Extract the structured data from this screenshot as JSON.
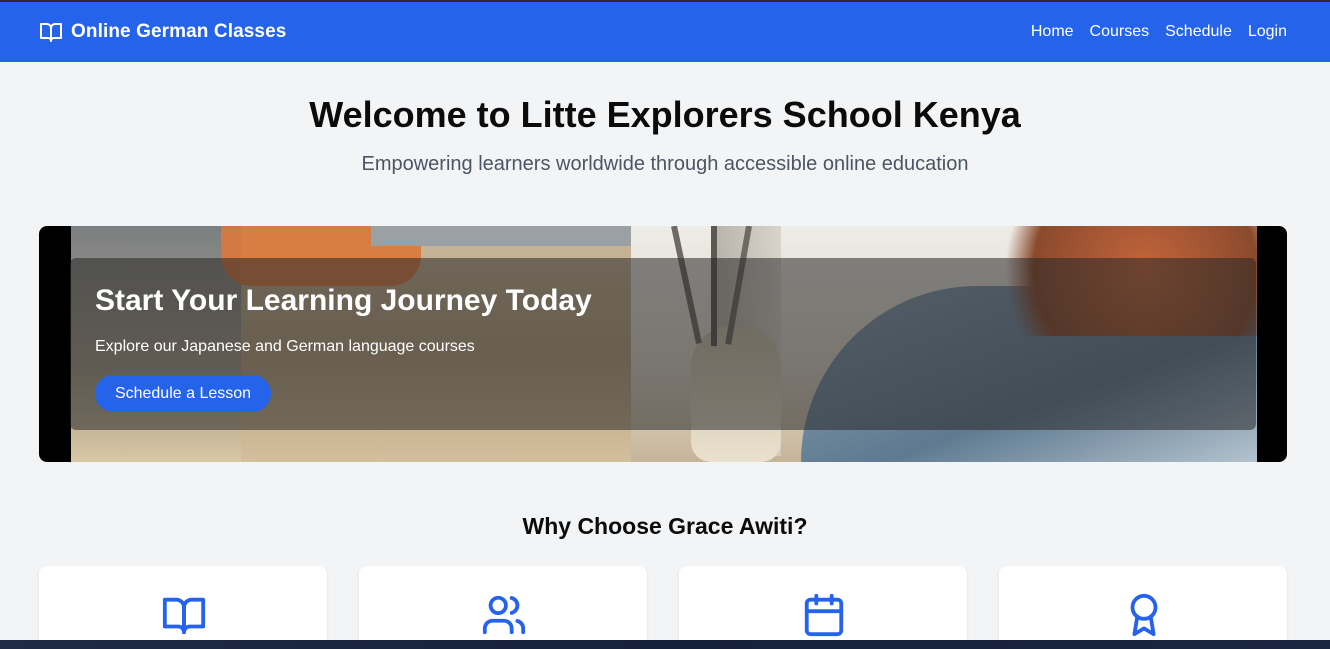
{
  "navbar": {
    "brand_icon": "book-open-icon",
    "brand_title": "Online German Classes",
    "links": [
      {
        "label": "Home"
      },
      {
        "label": "Courses"
      },
      {
        "label": "Schedule"
      },
      {
        "label": "Login"
      }
    ],
    "color": "#2563eb"
  },
  "hero": {
    "heading": "Welcome to Litte Explorers School Kenya",
    "subheading": "Empowering learners worldwide through accessible online education"
  },
  "banner": {
    "title": "Start Your Learning Journey Today",
    "text": "Explore our Japanese and German language courses",
    "cta_label": "Schedule a Lesson"
  },
  "features": {
    "title": "Why Choose Grace Awiti?",
    "cards": [
      {
        "icon": "book-open-icon"
      },
      {
        "icon": "users-icon"
      },
      {
        "icon": "calendar-icon"
      },
      {
        "icon": "award-icon"
      }
    ]
  }
}
